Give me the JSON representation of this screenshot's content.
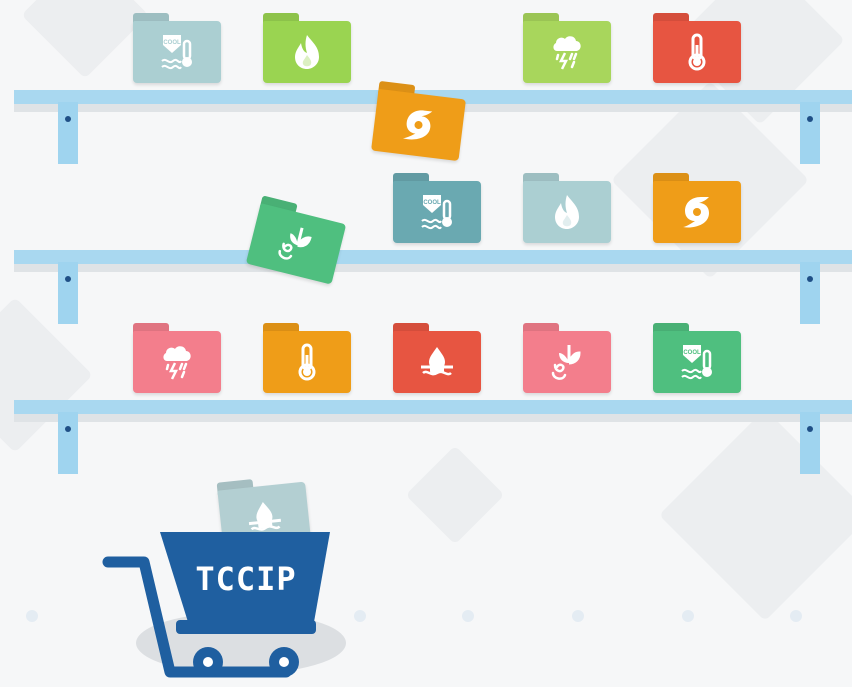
{
  "scene": {
    "background": "#f6f7f8",
    "shelf_color": "#a9d8f0",
    "cart_color": "#1f5fa0"
  },
  "cart": {
    "label": "TCCIP",
    "folder_in_cart": {
      "icon": "flood-icon",
      "color": "#b3cfd2"
    }
  },
  "shelves": [
    {
      "folders": [
        {
          "icon": "cooling-icon",
          "color": "#abcfd2",
          "cool_text": "COOL"
        },
        {
          "icon": "fire-icon",
          "color": "#9ad451"
        },
        {
          "icon": "storm-icon",
          "color": "#a8d65c"
        },
        {
          "icon": "thermometer-icon",
          "color": "#e75541"
        }
      ],
      "falling_folder": {
        "icon": "typhoon-icon",
        "color": "#ef9d18"
      }
    },
    {
      "folders": [
        {
          "icon": "cooling-icon",
          "color": "#6aa9b1",
          "cool_text": "COOL"
        },
        {
          "icon": "fire-icon",
          "color": "#abcfd2"
        },
        {
          "icon": "typhoon-icon",
          "color": "#ef9d18"
        }
      ],
      "falling_folder": {
        "icon": "drought-icon",
        "color": "#4fbf7f"
      }
    },
    {
      "folders": [
        {
          "icon": "storm-icon",
          "color": "#f37e8c"
        },
        {
          "icon": "thermometer-icon",
          "color": "#ef9d18"
        },
        {
          "icon": "flood-icon",
          "color": "#e75541"
        },
        {
          "icon": "drought-icon",
          "color": "#f37e8c"
        },
        {
          "icon": "cooling-icon",
          "color": "#4fbf7f",
          "cool_text": "COOL"
        }
      ]
    }
  ]
}
